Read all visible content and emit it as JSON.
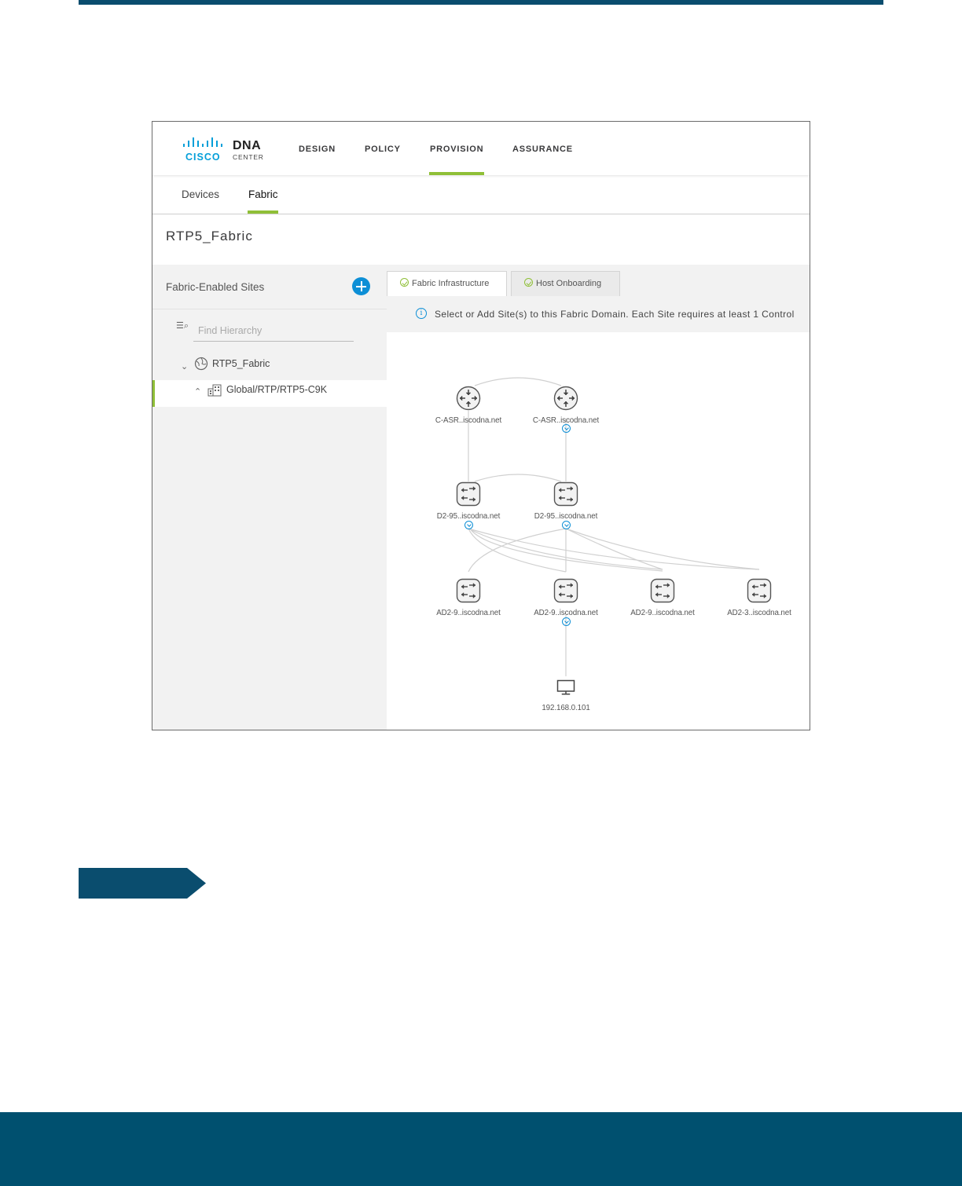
{
  "header": {
    "logo_cisco": "CISCO",
    "logo_dna": "DNA",
    "logo_center": "CENTER",
    "nav": [
      "DESIGN",
      "POLICY",
      "PROVISION",
      "ASSURANCE"
    ],
    "active_nav": "PROVISION"
  },
  "subtabs": [
    "Devices",
    "Fabric"
  ],
  "active_subtab": "Fabric",
  "page_title": "RTP5_Fabric",
  "left_pane": {
    "title": "Fabric-Enabled Sites",
    "search_placeholder": "Find Hierarchy",
    "tree": [
      {
        "label": "RTP5_Fabric",
        "expanded": true
      },
      {
        "label": "Global/RTP/RTP5-C9K",
        "selected": true
      }
    ]
  },
  "right_pane": {
    "tabs": [
      "Fabric Infrastructure",
      "Host Onboarding"
    ],
    "active_tab": "Fabric Infrastructure",
    "info_text": "Select or Add Site(s) to this Fabric Domain. Each Site requires at least 1 Control"
  },
  "topology": {
    "nodes": [
      {
        "id": "c1",
        "type": "router",
        "label": "C-ASR..iscodna.net"
      },
      {
        "id": "c2",
        "type": "router",
        "label": "C-ASR..iscodna.net"
      },
      {
        "id": "d1",
        "type": "switch",
        "label": "D2-95..iscodna.net"
      },
      {
        "id": "d2",
        "type": "switch",
        "label": "D2-95..iscodna.net"
      },
      {
        "id": "a1",
        "type": "switch",
        "label": "AD2-9..iscodna.net"
      },
      {
        "id": "a2",
        "type": "switch",
        "label": "AD2-9..iscodna.net"
      },
      {
        "id": "a3",
        "type": "switch",
        "label": "AD2-9..iscodna.net"
      },
      {
        "id": "a4",
        "type": "switch",
        "label": "AD2-3..iscodna.net"
      },
      {
        "id": "h1",
        "type": "host",
        "label": "192.168.0.101"
      }
    ]
  },
  "colors": {
    "accent_green": "#8fbf37",
    "brand_blue": "#049fd9",
    "action_blue": "#0d8fd6",
    "page_band": "#00506f"
  }
}
